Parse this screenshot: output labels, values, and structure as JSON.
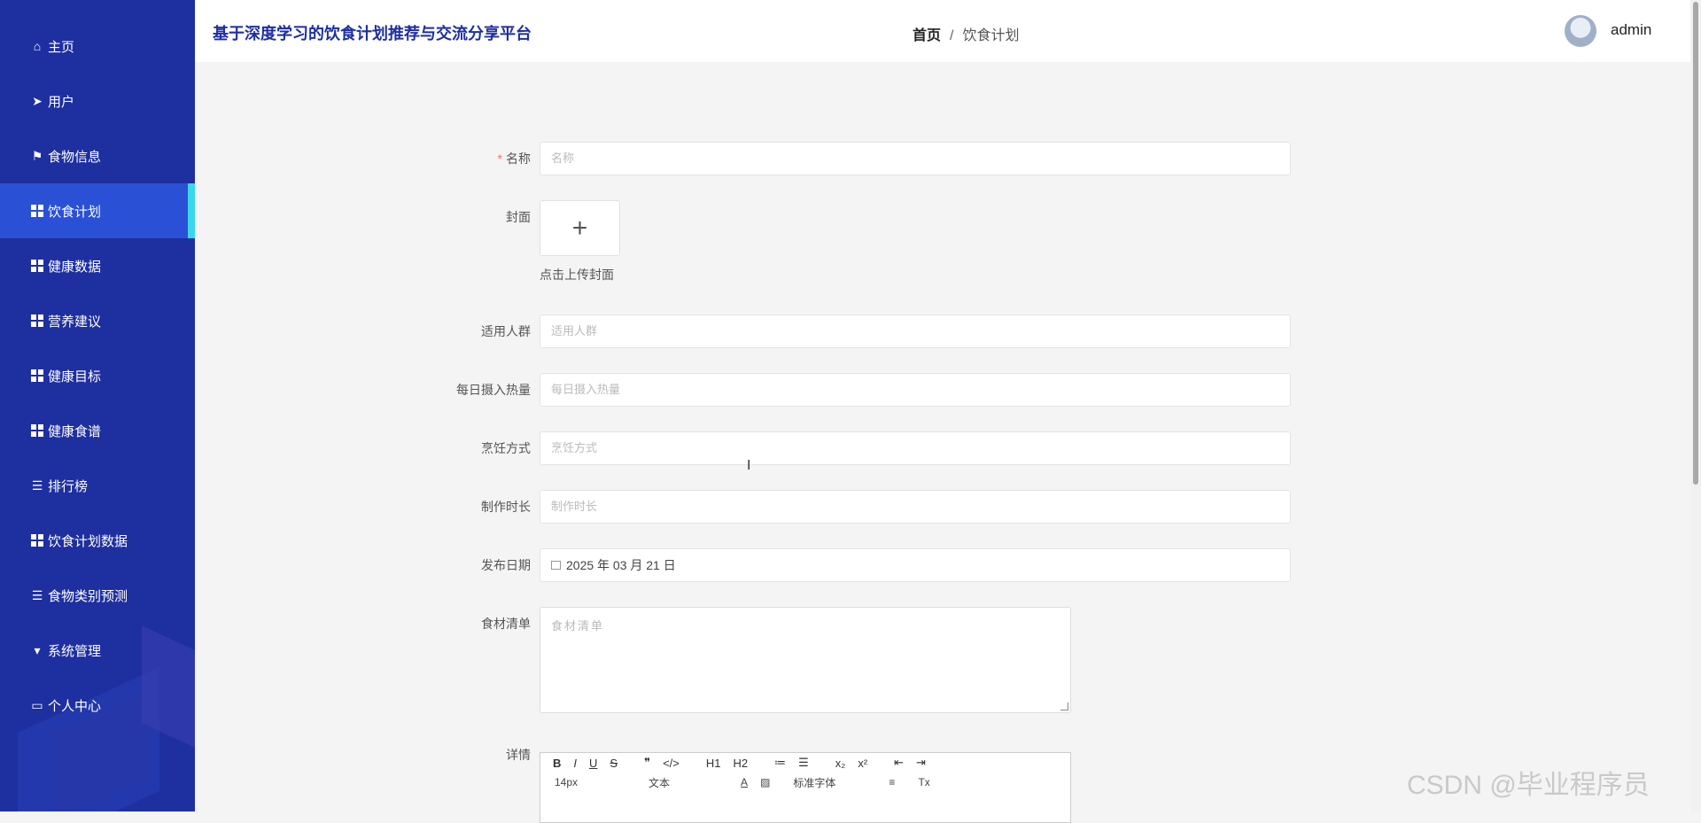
{
  "app": {
    "title": "基于深度学习的饮食计划推荐与交流分享平台",
    "user": "admin"
  },
  "breadcrumb": {
    "home": "首页",
    "separator": "/",
    "current": "饮食计划"
  },
  "sidebar": {
    "items": [
      {
        "label": "主页",
        "icon": "home-icon"
      },
      {
        "label": "用户",
        "icon": "send-icon"
      },
      {
        "label": "食物信息",
        "icon": "flag-icon"
      },
      {
        "label": "饮食计划",
        "icon": "grid-icon",
        "active": true
      },
      {
        "label": "健康数据",
        "icon": "grid-icon"
      },
      {
        "label": "营养建议",
        "icon": "grid-icon"
      },
      {
        "label": "健康目标",
        "icon": "grid-icon"
      },
      {
        "label": "健康食谱",
        "icon": "grid-icon"
      },
      {
        "label": "排行榜",
        "icon": "list-icon"
      },
      {
        "label": "饮食计划数据",
        "icon": "grid-icon"
      },
      {
        "label": "食物类别预测",
        "icon": "list-icon"
      },
      {
        "label": "系统管理",
        "icon": "brush-icon"
      },
      {
        "label": "个人中心",
        "icon": "card-icon"
      }
    ]
  },
  "form": {
    "name": {
      "label": "名称",
      "placeholder": "名称",
      "required": "*"
    },
    "cover": {
      "label": "封面",
      "plus": "+",
      "tip": "点击上传封面"
    },
    "audience": {
      "label": "适用人群",
      "placeholder": "适用人群"
    },
    "calories": {
      "label": "每日摄入热量",
      "placeholder": "每日摄入热量"
    },
    "cooking": {
      "label": "烹饪方式",
      "placeholder": "烹饪方式"
    },
    "duration": {
      "label": "制作时长",
      "placeholder": "制作时长"
    },
    "publish_date": {
      "label": "发布日期",
      "value": "2025 年 03 月 21 日"
    },
    "ingredients": {
      "label": "食材清单",
      "placeholder": "食材清单"
    },
    "details": {
      "label": "详情"
    }
  },
  "editor": {
    "row1": [
      "B",
      "I",
      "U",
      "S",
      "❞",
      "</>",
      "H1",
      "H2",
      "≔",
      "☰",
      "x₂",
      "x²",
      "⇤",
      "⇥"
    ],
    "font_size": "14px",
    "text_type": "文本",
    "font_family": "标准字体",
    "clear": "Tx"
  },
  "watermark": "CSDN @毕业程序员"
}
